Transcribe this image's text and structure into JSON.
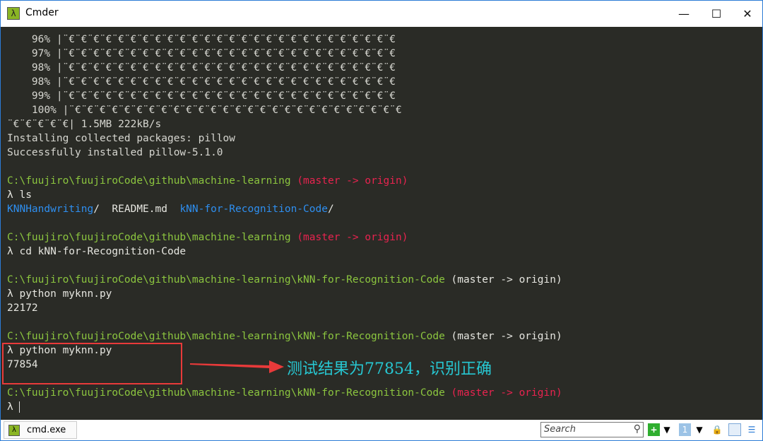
{
  "window": {
    "title": "Cmder",
    "app_icon": "lambda-icon",
    "minimize": "—",
    "maximize": "☐",
    "close": "✕"
  },
  "terminal": {
    "lines": [
      [
        {
          "t": "    96% |¨€¨€¨€¨€¨€¨€¨€¨€¨€¨€¨€¨€¨€¨€¨€¨€¨€¨€¨€¨€¨€¨€¨€¨€¨€¨€¨€",
          "c": ""
        }
      ],
      [
        {
          "t": "    97% |¨€¨€¨€¨€¨€¨€¨€¨€¨€¨€¨€¨€¨€¨€¨€¨€¨€¨€¨€¨€¨€¨€¨€¨€¨€¨€¨€",
          "c": ""
        }
      ],
      [
        {
          "t": "    98% |¨€¨€¨€¨€¨€¨€¨€¨€¨€¨€¨€¨€¨€¨€¨€¨€¨€¨€¨€¨€¨€¨€¨€¨€¨€¨€¨€",
          "c": ""
        }
      ],
      [
        {
          "t": "    98% |¨€¨€¨€¨€¨€¨€¨€¨€¨€¨€¨€¨€¨€¨€¨€¨€¨€¨€¨€¨€¨€¨€¨€¨€¨€¨€¨€",
          "c": ""
        }
      ],
      [
        {
          "t": "    99% |¨€¨€¨€¨€¨€¨€¨€¨€¨€¨€¨€¨€¨€¨€¨€¨€¨€¨€¨€¨€¨€¨€¨€¨€¨€¨€¨€",
          "c": ""
        }
      ],
      [
        {
          "t": "    100% |¨€¨€¨€¨€¨€¨€¨€¨€¨€¨€¨€¨€¨€¨€¨€¨€¨€¨€¨€¨€¨€¨€¨€¨€¨€¨€¨€",
          "c": ""
        }
      ],
      [
        {
          "t": "¨€¨€¨€¨€¨€| 1.5MB 222kB/s",
          "c": ""
        }
      ],
      [
        {
          "t": "Installing collected packages: pillow",
          "c": ""
        }
      ],
      [
        {
          "t": "Successfully installed pillow-5.1.0",
          "c": ""
        }
      ],
      [
        {
          "t": "",
          "c": ""
        }
      ],
      [
        {
          "t": "C:\\fuujiro\\fuujiroCode\\github\\machine-learning ",
          "c": "g"
        },
        {
          "t": "(master -> origin)",
          "c": "r"
        }
      ],
      [
        {
          "t": "λ ls",
          "c": "w"
        }
      ],
      [
        {
          "t": "KNNHandwriting",
          "c": "b"
        },
        {
          "t": "/  README.md  ",
          "c": "w"
        },
        {
          "t": "kNN-for-Recognition-Code",
          "c": "b"
        },
        {
          "t": "/",
          "c": "w"
        }
      ],
      [
        {
          "t": "",
          "c": ""
        }
      ],
      [
        {
          "t": "C:\\fuujiro\\fuujiroCode\\github\\machine-learning ",
          "c": "g"
        },
        {
          "t": "(master -> origin)",
          "c": "r"
        }
      ],
      [
        {
          "t": "λ cd kNN-for-Recognition-Code",
          "c": "w"
        }
      ],
      [
        {
          "t": "",
          "c": ""
        }
      ],
      [
        {
          "t": "C:\\fuujiro\\fuujiroCode\\github\\machine-learning\\kNN-for-Recognition-Code ",
          "c": "g"
        },
        {
          "t": "(master -> origin)",
          "c": "w"
        }
      ],
      [
        {
          "t": "λ python myknn.py",
          "c": "w"
        }
      ],
      [
        {
          "t": "22172",
          "c": "w"
        }
      ],
      [
        {
          "t": "",
          "c": ""
        }
      ],
      [
        {
          "t": "C:\\fuujiro\\fuujiroCode\\github\\machine-learning\\kNN-for-Recognition-Code ",
          "c": "g"
        },
        {
          "t": "(master -> origin)",
          "c": "w"
        }
      ],
      [
        {
          "t": "λ python myknn.py",
          "c": "w"
        }
      ],
      [
        {
          "t": "77854",
          "c": "w"
        }
      ],
      [
        {
          "t": "",
          "c": ""
        }
      ],
      [
        {
          "t": "C:\\fuujiro\\fuujiroCode\\github\\machine-learning\\kNN-for-Recognition-Code ",
          "c": "g"
        },
        {
          "t": "(master -> origin)",
          "c": "r"
        }
      ],
      [
        {
          "t": "λ ",
          "c": "w"
        }
      ]
    ]
  },
  "annotation": {
    "text": "测试结果为77854，识别正确",
    "color": "#27c7d2",
    "box_color": "#e83a3a"
  },
  "statusbar": {
    "tab_label": "cmd.exe",
    "search_placeholder": "Search"
  },
  "colors": {
    "path": "#8cc63f",
    "branch": "#e8234f",
    "dir": "#2e8ff0",
    "background": "#2a2b26"
  }
}
